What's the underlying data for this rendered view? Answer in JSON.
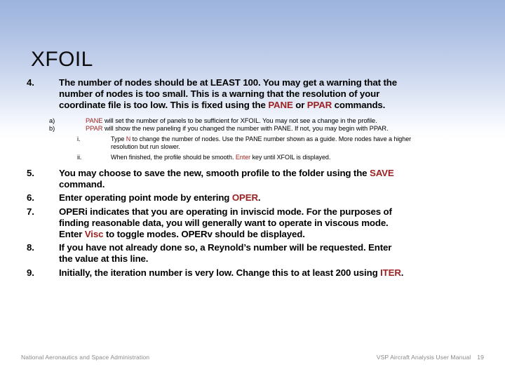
{
  "slide": {
    "title": "XFOIL",
    "background_top_color": "#9db4de",
    "background_bottom_color": "#ffffff",
    "keyword_color": "#9b2222",
    "body_text_color": "#000000",
    "footer_text_color": "#8a8a8a"
  },
  "items": {
    "item4": {
      "marker": "4.",
      "text_1": "The number of nodes should be at LEAST 100.  You may get a warning that the number of nodes is too small.  This is a warning that the resolution of your coordinate file is too low.  This is fixed using the ",
      "kw_1": "PANE",
      "text_2": " or ",
      "kw_2": "PPAR",
      "text_3": " commands."
    },
    "item4a": {
      "marker": "a)",
      "kw_1": "PANE",
      "text_1": " will set the number of panels to be sufficient for XFOIL.  You may not see a change in the profile."
    },
    "item4b": {
      "marker": "b)",
      "kw_1": "PPAR",
      "text_1": " will show the new paneling if you changed the number with PANE.  If not, you may begin with PPAR."
    },
    "item4bi": {
      "marker": "i.",
      "text_1": "Type ",
      "kw_1": "N",
      "text_2": " to change the number of nodes.  Use the PANE number shown as a guide.  More nodes have a higher resolution but run slower."
    },
    "item4bii": {
      "marker": "ii.",
      "text_1": "When finished, the profile should be smooth.  ",
      "kw_1": "Enter",
      "text_2": " key until XFOIL is displayed."
    },
    "item5": {
      "marker": "5.",
      "text_1": "You may choose to save the new, smooth profile to the folder using the ",
      "kw_1": "SAVE",
      "text_2": " command."
    },
    "item6": {
      "marker": "6.",
      "text_1": "Enter operating point mode by entering ",
      "kw_1": "OPER",
      "text_2": "."
    },
    "item7": {
      "marker": "7.",
      "text_1": "OPERi indicates that you are operating in inviscid mode.  For the purposes of finding reasonable data, you will generally want to operate in viscous mode.  Enter ",
      "kw_1": "Visc",
      "text_2": " to toggle modes.  OPERv should be displayed."
    },
    "item8": {
      "marker": "8.",
      "text_1": "If you have not already done so, a Reynold’s number will be requested.  Enter the value at this line.",
      "kw_1": "",
      "text_2": ""
    },
    "item9": {
      "marker": "9.",
      "text_1": "Initially, the iteration number is very low.  Change this to at least 200 using ",
      "kw_1": "ITER",
      "text_2": "."
    }
  },
  "footer": {
    "left": "National Aeronautics and Space Administration",
    "right": "VSP Aircraft Analysis User Manual",
    "page_number": "19"
  }
}
